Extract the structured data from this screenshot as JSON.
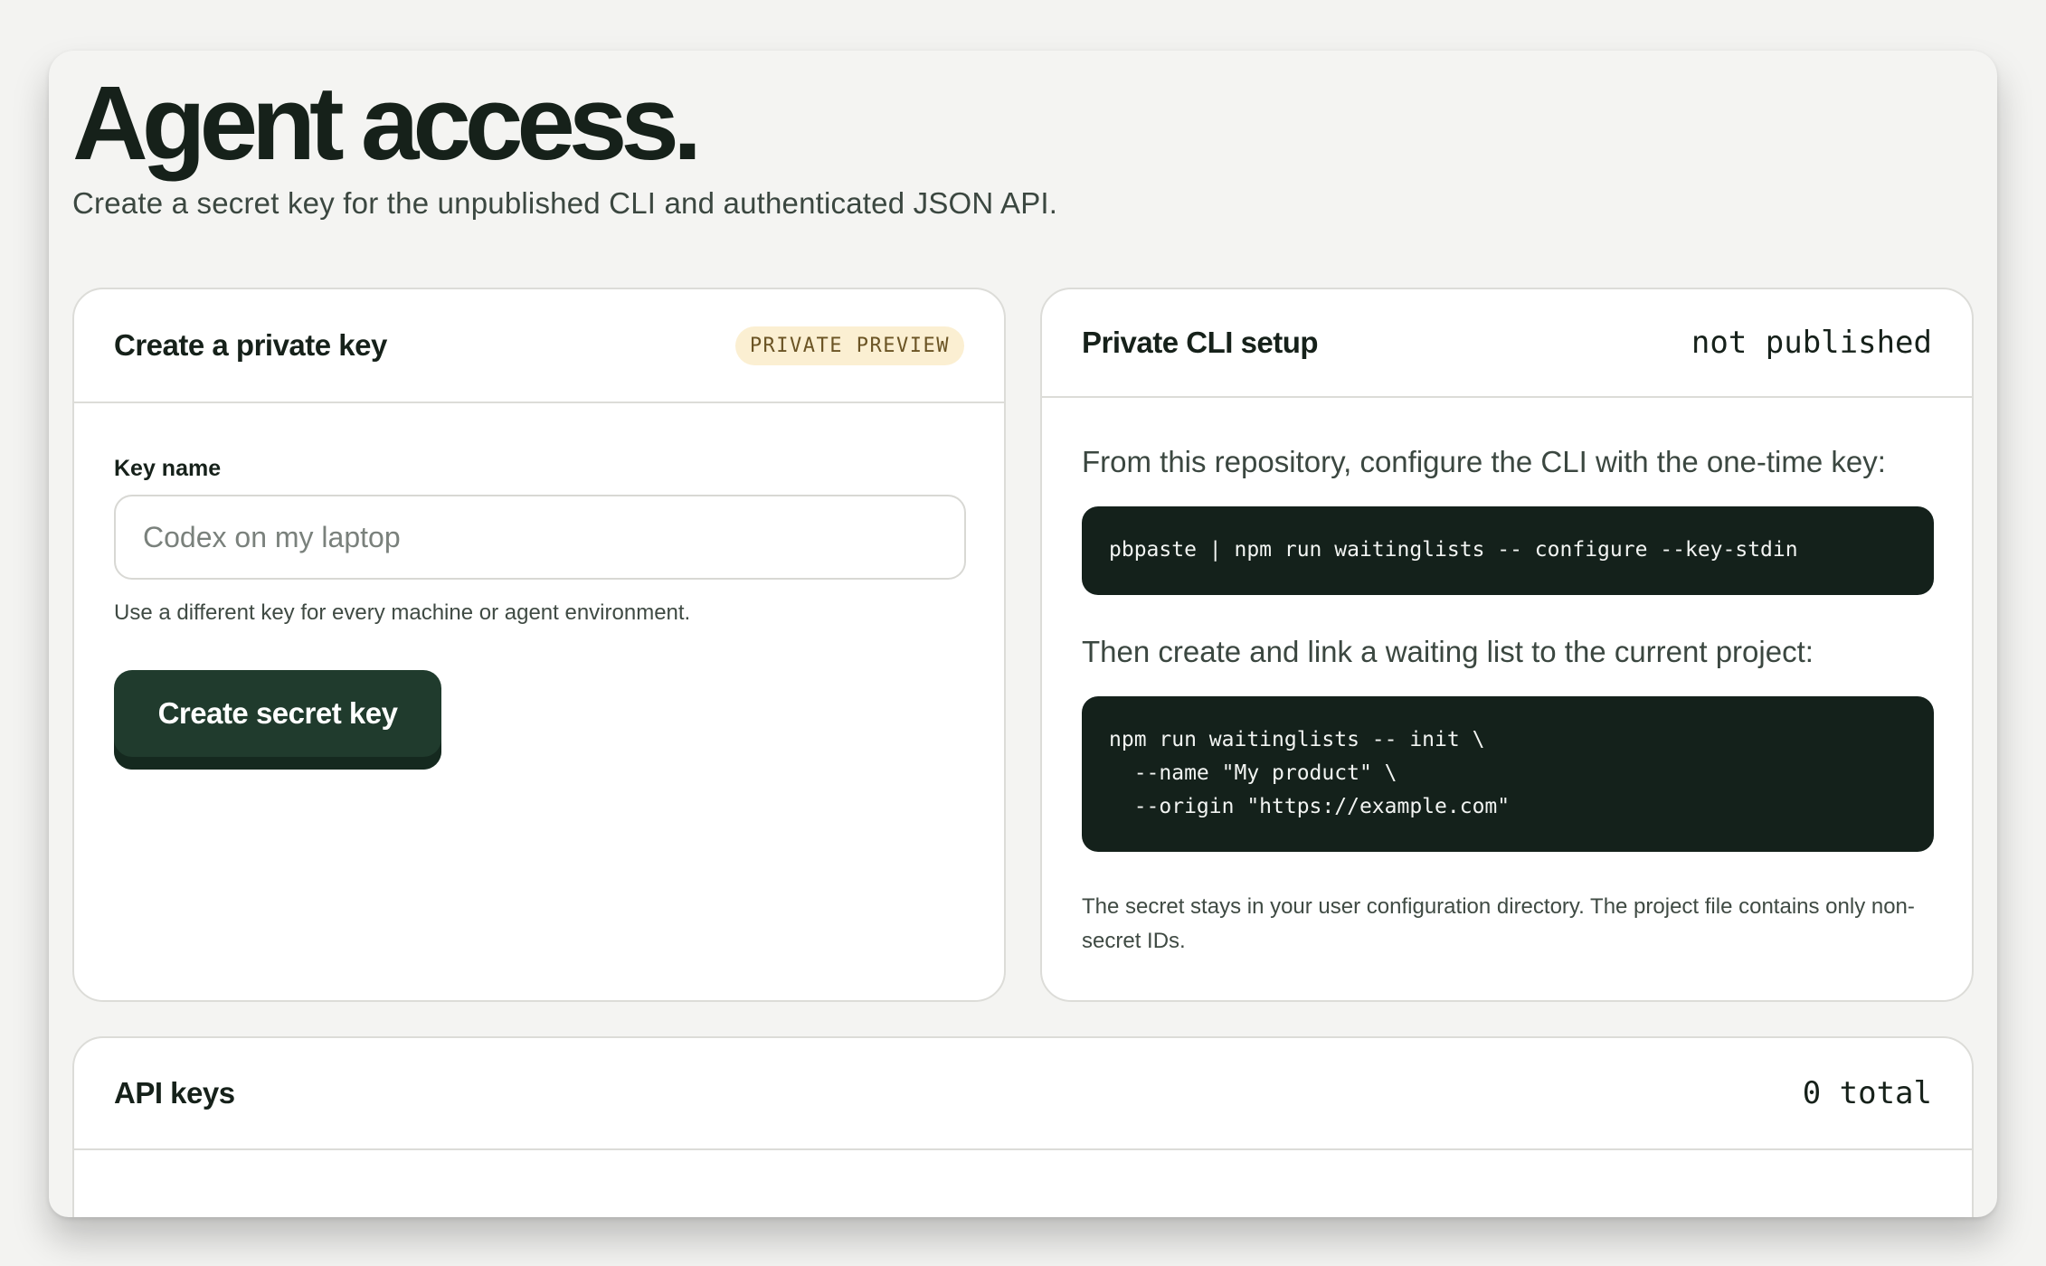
{
  "page": {
    "title": "Agent access.",
    "subtitle": "Create a secret key for the unpublished CLI and authenticated JSON API."
  },
  "create_key": {
    "title": "Create a private key",
    "badge": "PRIVATE PREVIEW",
    "field_label": "Key name",
    "input_value": "",
    "input_placeholder": "Codex on my laptop",
    "help_text": "Use a different key for every machine or agent environment.",
    "button_label": "Create secret key"
  },
  "cli_setup": {
    "title": "Private CLI setup",
    "status": "not published",
    "step1_text": "From this repository, configure the CLI with the one-time key:",
    "step1_code": "pbpaste | npm run waitinglists -- configure --key-stdin",
    "step2_text": "Then create and link a waiting list to the current project:",
    "step2_code": "npm run waitinglists -- init \\\n  --name \"My product\" \\\n  --origin \"https://example.com\"",
    "footnote": "The secret stays in your user configuration directory. The project file contains only non-secret IDs."
  },
  "api_keys": {
    "title": "API keys",
    "count": "0 total"
  },
  "colors": {
    "page_background": "#f4f4f2",
    "card_background": "#ffffff",
    "primary_button": "#203b2d",
    "code_background": "#14211b",
    "badge_background": "#fbefd2",
    "badge_text": "#6b5424"
  }
}
